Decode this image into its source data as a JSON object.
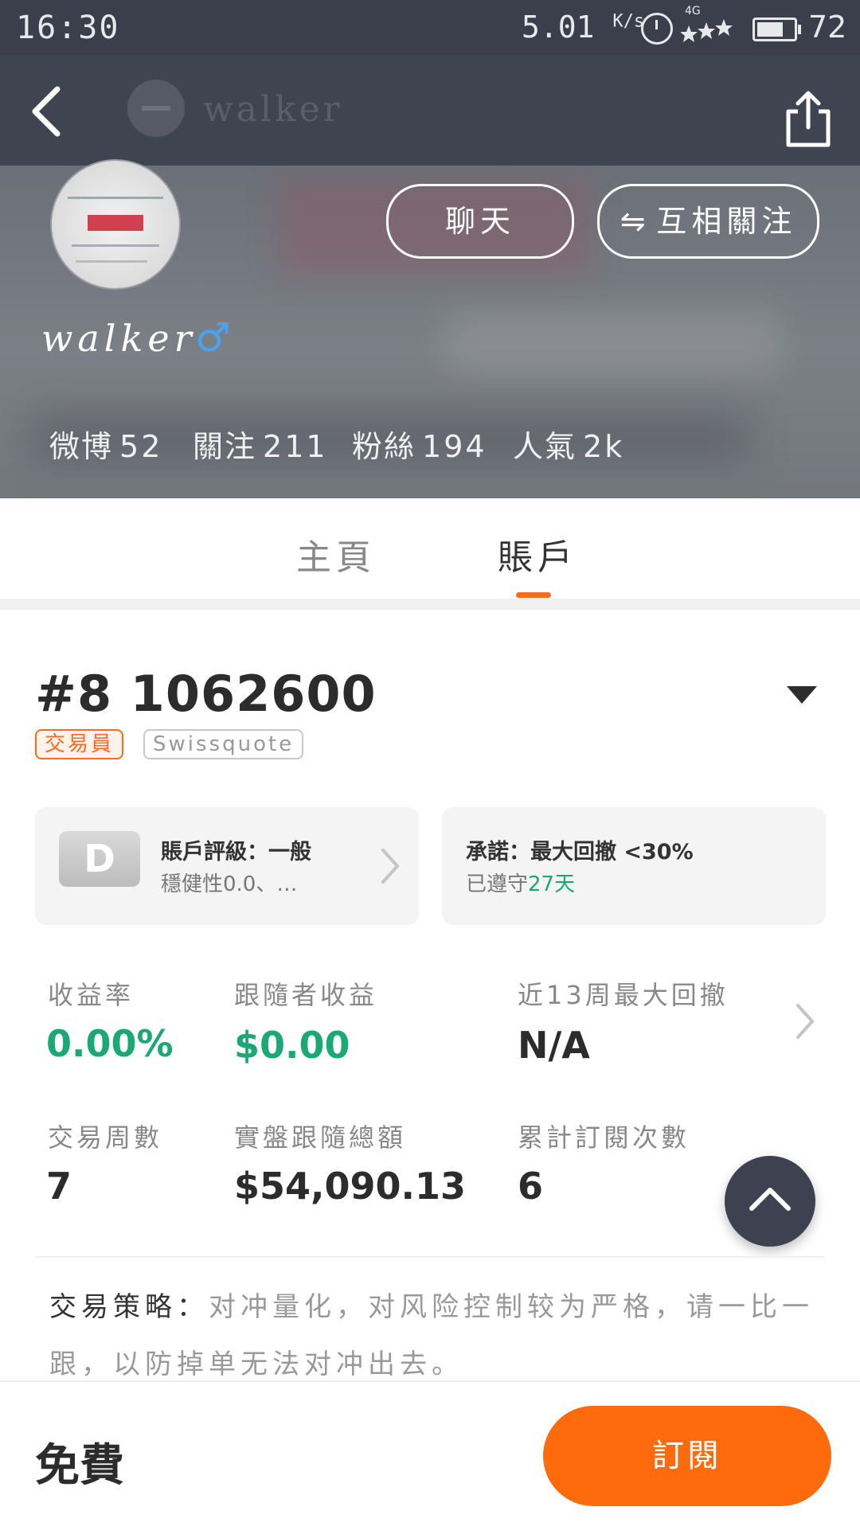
{
  "status_bar": {
    "time": "16:30",
    "speed": "5.01",
    "speed_unit": "K/s",
    "network": "4G",
    "battery_level": "72",
    "battery_fill": 0.72
  },
  "nav": {
    "title": "walker"
  },
  "profile": {
    "buttons": {
      "chat": "聊天",
      "follow_icon": "⇋",
      "follow": "互相關注"
    },
    "username": "walker",
    "gender_icon": "♂",
    "stats": [
      {
        "label": "微博",
        "value": "52"
      },
      {
        "label": "關注",
        "value": "211"
      },
      {
        "label": "粉絲",
        "value": "194"
      },
      {
        "label": "人氣",
        "value": "2k"
      }
    ]
  },
  "tabs": [
    {
      "label": "主頁"
    },
    {
      "label": "賬戶"
    }
  ],
  "account": {
    "number": "#8 1062600",
    "tags": [
      "交易員",
      "Swissquote"
    ],
    "rating_card": {
      "badge": "D",
      "title": "賬戶評級：一般",
      "subtitle": "穩健性0.0、…"
    },
    "promise_card": {
      "title": "承諾：最大回撤 <30%",
      "subtitle_prefix": "已遵守",
      "subtitle_days": "27天"
    },
    "metrics": [
      {
        "label": "收益率",
        "value": "0.00%"
      },
      {
        "label": "跟隨者收益",
        "value": "$0.00"
      },
      {
        "label": "近13周最大回撤",
        "value": "N/A"
      },
      {
        "label": "交易周數",
        "value": "7"
      },
      {
        "label": "實盤跟隨總額",
        "value": "$54,090.13"
      },
      {
        "label": "累計訂閱次數",
        "value": "6"
      }
    ],
    "strategy": {
      "lead": "交易策略：",
      "text": "对冲量化，对风险控制较为严格，请一比一跟，以防掉单无法对冲出去。"
    }
  },
  "bottom": {
    "price": "免費",
    "subscribe": "訂閱"
  },
  "colors": {
    "accent": "#ff6a0d",
    "positive": "#1aa874",
    "gender": "#4aa3f0"
  }
}
